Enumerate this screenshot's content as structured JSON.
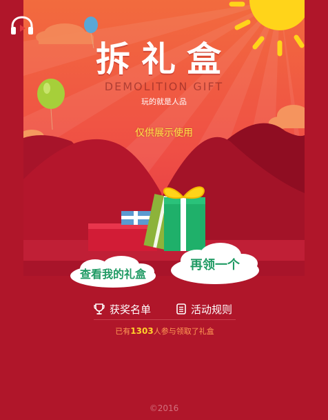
{
  "hero": {
    "title": "拆礼盒",
    "subtitle_en": "DEMOLITION GIFT",
    "tagline": "玩的就是人品",
    "demo_note": "仅供展示使用"
  },
  "buttons": {
    "view_gifts": "查看我的礼盒",
    "claim_again": "再领一个"
  },
  "nav": {
    "winners": "获奖名单",
    "rules": "活动规则"
  },
  "participants": {
    "prefix": "已有",
    "count": "1303",
    "suffix": "人参与领取了礼盒"
  },
  "footer": {
    "copyright": "©2016"
  },
  "icons": {
    "music": "headphones-icon",
    "winners": "trophy-icon",
    "rules": "document-icon"
  },
  "colors": {
    "page_bg": "#b0162a",
    "accent_green": "#1f9a63",
    "highlight_yellow": "#ffd12a",
    "sky_top": "#f06a3c",
    "sun": "#ffd41a"
  }
}
